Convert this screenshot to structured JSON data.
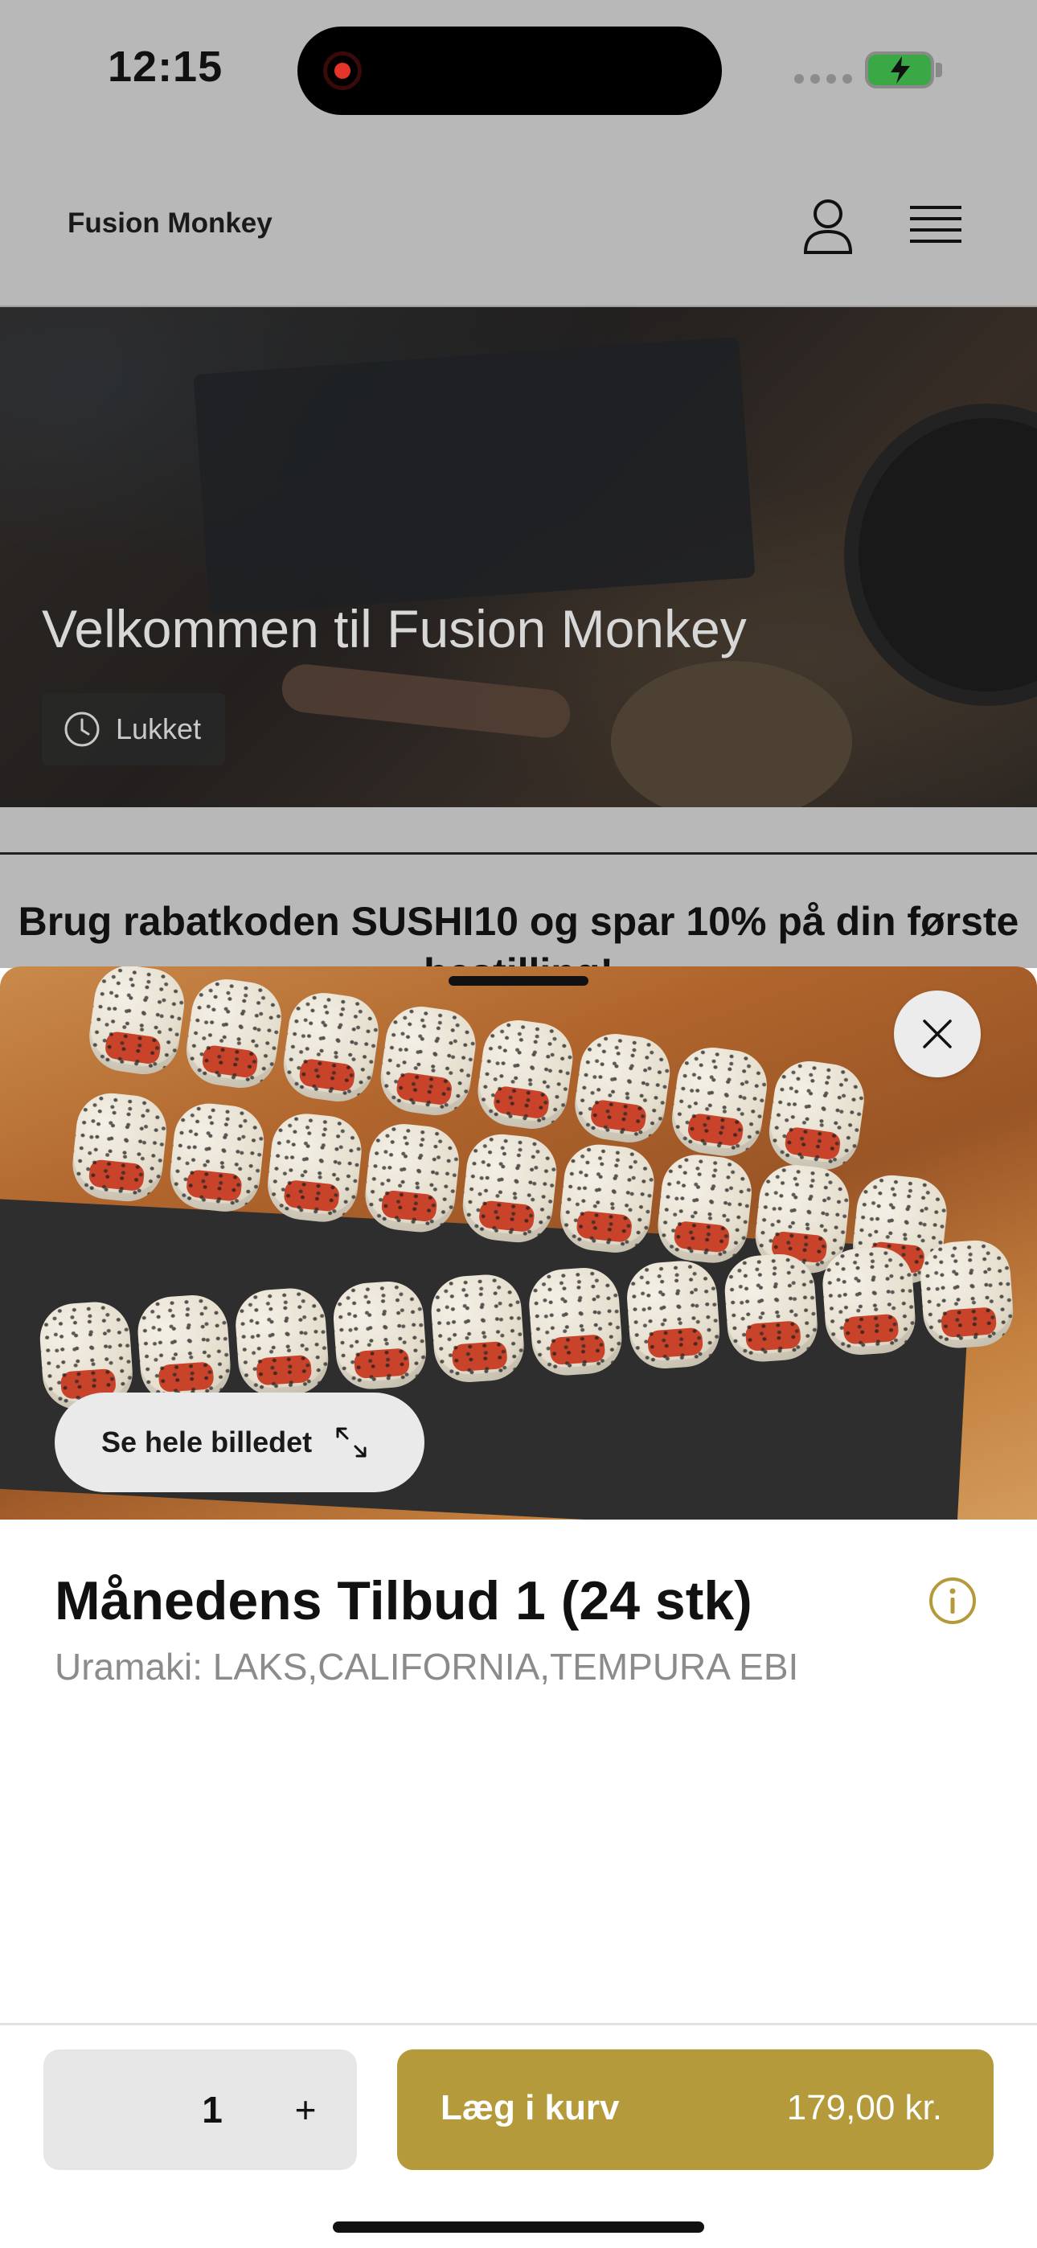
{
  "status_bar": {
    "time": "12:15"
  },
  "header": {
    "brand": "Fusion Monkey"
  },
  "hero": {
    "title": "Velkommen til Fusion Monkey",
    "status_label": "Lukket"
  },
  "promo": {
    "line1": "Brug rabatkoden SUSHI10 og spar 10% på din første",
    "line2": "bestilling!"
  },
  "sheet": {
    "view_image_label": "Se hele billedet",
    "product_name": "Månedens Tilbud 1 (24 stk)",
    "product_description": "Uramaki: LAKS,CALIFORNIA,TEMPURA EBI",
    "quantity": "1",
    "plus_label": "+",
    "add_to_cart_label": "Læg i kurv",
    "price": "179,00 kr.",
    "accent_color": "#b59a3c"
  }
}
